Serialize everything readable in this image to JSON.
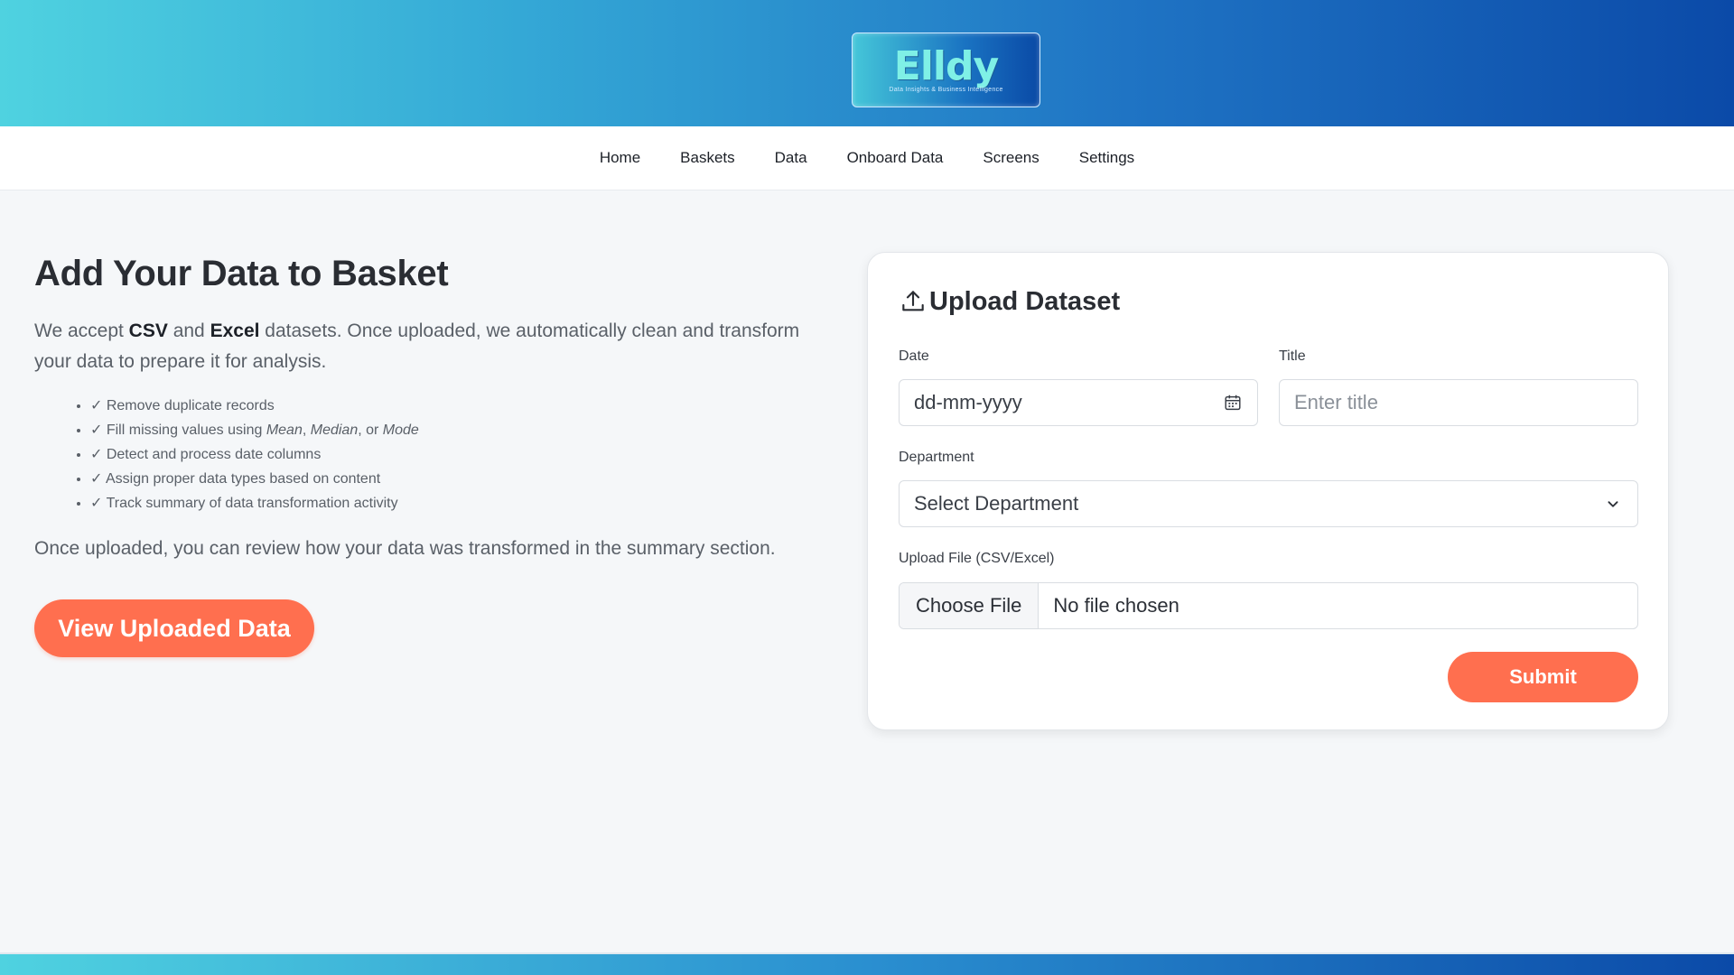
{
  "logo": {
    "word": "Elldy",
    "tagline": "Data Insights & Business Intelligence"
  },
  "nav": {
    "items": [
      {
        "label": "Home"
      },
      {
        "label": "Baskets"
      },
      {
        "label": "Data"
      },
      {
        "label": "Onboard Data"
      },
      {
        "label": "Screens"
      },
      {
        "label": "Settings"
      }
    ]
  },
  "main": {
    "heading": "Add Your Data to Basket",
    "intro": {
      "prefix": "We accept ",
      "format1": "CSV",
      "and": " and ",
      "format2": "Excel",
      "suffix": " datasets. Once uploaded, we automatically clean and transform your data to prepare it for analysis."
    },
    "features": [
      "✓ Remove duplicate records",
      "✓ Detect and process date columns",
      "✓ Assign proper data types based on content",
      "✓ Track summary of data transformation activity"
    ],
    "feature_missing": {
      "prefix": "✓ Fill missing values using ",
      "m1": "Mean",
      "sep1": ", ",
      "m2": "Median",
      "sep2": ", or ",
      "m3": "Mode"
    },
    "outro": "Once uploaded, you can review how your data was transformed in the summary section.",
    "view_button": "View Uploaded Data"
  },
  "form": {
    "title": "Upload Dataset",
    "title_icon": "upload-icon",
    "date_label": "Date",
    "date_placeholder": "dd-mm-yyyy",
    "date_icon": "calendar-icon",
    "title_label": "Title",
    "title_placeholder": "Enter title",
    "department_label": "Department",
    "department_selected": "Select Department",
    "department_icon": "chevron-down-icon",
    "file_label": "Upload File (CSV/Excel)",
    "choose_file": "Choose File",
    "file_status": "No file chosen",
    "submit": "Submit"
  },
  "colors": {
    "accent": "#ff6f4f",
    "header_start": "#4fd2e0",
    "header_end": "#0b4aa8"
  }
}
